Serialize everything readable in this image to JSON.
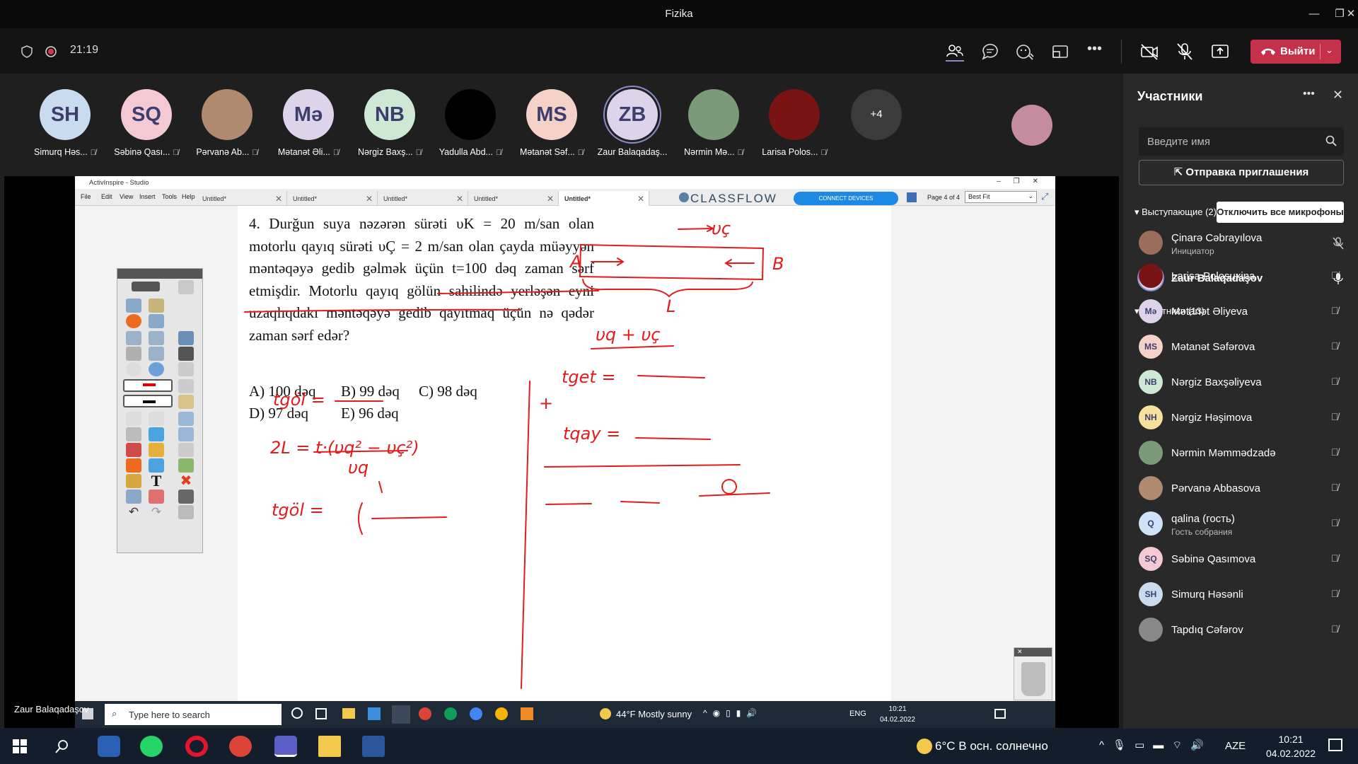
{
  "window": {
    "title": "Fizika"
  },
  "meeting": {
    "elapsed": "21:19",
    "leave_label": "Выйти"
  },
  "strip": {
    "participants": [
      {
        "initials": "SH",
        "name": "Simurq Həs...",
        "color": "#c9dbef"
      },
      {
        "initials": "SQ",
        "name": "Səbinə Qası...",
        "color": "#f3c9d3"
      },
      {
        "initials": "",
        "name": "Pərvanə Ab...",
        "color": "#b08a70"
      },
      {
        "initials": "Mə",
        "name": "Mətanət Əli...",
        "color": "#ddd4ec"
      },
      {
        "initials": "NB",
        "name": "Nərgiz Baxş...",
        "color": "#cfe8d5"
      },
      {
        "initials": "",
        "name": "Yadulla Abd...",
        "color": "#000000"
      },
      {
        "initials": "MS",
        "name": "Mətanət Səf...",
        "color": "#f4d2c8"
      },
      {
        "initials": "ZB",
        "name": "Zaur Balaqadaş...",
        "color": "#ddd4ec"
      },
      {
        "initials": "",
        "name": "Nərmin Mə...",
        "color": "#7a9a78"
      },
      {
        "initials": "",
        "name": "Larisa Polos...",
        "color": "#7a1414"
      }
    ],
    "overflow": "+4"
  },
  "inspire": {
    "title": "ActivInspire - Studio",
    "menus": [
      "File",
      "Edit",
      "View",
      "Insert",
      "Tools",
      "Help"
    ],
    "tabs": [
      "Untitled*",
      "Untitled*",
      "Untitled*",
      "Untitled*",
      "Untitled*"
    ],
    "brand": "CLASSFLOW",
    "connect": "CONNECT DEVICES",
    "page": "Page 4 of 4",
    "fit": "Best Fit"
  },
  "problem": {
    "text": "4. Durğun suya nəzərən sürəti υK = 20 m/san olan motorlu qayıq sürəti υÇ = 2 m/san olan çayda müəyyən məntəqəyə gedib gəlmək üçün t=100 dəq zaman sərf etmişdir. Motorlu qayıq gölün sahilində yerləşən eyni uzaqlıqdakı məntəqəyə gedib qayıtmaq üçün nə qədər zaman sərf edər?",
    "answers": [
      "A) 100 dəq",
      "B) 99 dəq",
      "C) 98 dəq",
      "D) 97 dəq",
      "E) 96 dəq"
    ]
  },
  "handwriting": {
    "vq_label": "υç",
    "point_a": "A",
    "point_b": "B",
    "distance": "L",
    "sum": "υq + υç",
    "t_get": "tget =",
    "t_qay": "tqay =",
    "t_gol": "tgöl =",
    "two_l": "2L = t·(υq² − υç²)",
    "vq": "υq",
    "plus": "+"
  },
  "shared_taskbar": {
    "search": "Type here to search",
    "weather": "44°F  Mostly sunny",
    "lang": "ENG",
    "time": "10:21",
    "date": "04.02.2022"
  },
  "presenter": "Zaur Balaqadaşov",
  "panel": {
    "title": "Участники",
    "search_placeholder": "Введите имя",
    "invite": "Отправка приглашения",
    "presenters_label": "Выступающие (2)",
    "mute_all": "Отключить все микрофоны",
    "attendees_label": "Участники (13)",
    "presenters": [
      {
        "initials": "",
        "name": "Çinarə Cəbrayılova",
        "sub": "Инициатор",
        "color": "#9c6d5a",
        "mic": "muted"
      },
      {
        "initials": "ZB",
        "name": "Zaur Balaqadaşov",
        "sub": "",
        "color": "#ddd4ec",
        "mic": "on"
      }
    ],
    "attendees": [
      {
        "initials": "",
        "name": "Larisa Polosuxina",
        "sub": "",
        "color": "#7a1414"
      },
      {
        "initials": "Mə",
        "name": "Mətanət Əliyeva",
        "sub": "",
        "color": "#ddd4ec"
      },
      {
        "initials": "MS",
        "name": "Mətanət Səfərova",
        "sub": "",
        "color": "#f4d2c8"
      },
      {
        "initials": "NB",
        "name": "Nərgiz Baxşəliyeva",
        "sub": "",
        "color": "#cfe8d5"
      },
      {
        "initials": "NH",
        "name": "Nərgiz Həşimova",
        "sub": "",
        "color": "#f7df9e"
      },
      {
        "initials": "",
        "name": "Nərmin Məmmədzadə",
        "sub": "",
        "color": "#7a9a78"
      },
      {
        "initials": "",
        "name": "Pərvanə Abbasova",
        "sub": "",
        "color": "#b08a70"
      },
      {
        "initials": "Q",
        "name": "qalina (гость)",
        "sub": "Гость собрания",
        "color": "#cfe2f7"
      },
      {
        "initials": "SQ",
        "name": "Səbinə Qasımova",
        "sub": "",
        "color": "#f3c9d3"
      },
      {
        "initials": "SH",
        "name": "Simurq Həsənli",
        "sub": "",
        "color": "#c9dbef"
      },
      {
        "initials": "",
        "name": "Tapdıq Cəfərov",
        "sub": "",
        "color": "#888888"
      }
    ]
  },
  "win_taskbar": {
    "weather": "6°C  В осн. солнечно",
    "lang": "AZE",
    "time": "10:21",
    "date": "04.02.2022"
  }
}
